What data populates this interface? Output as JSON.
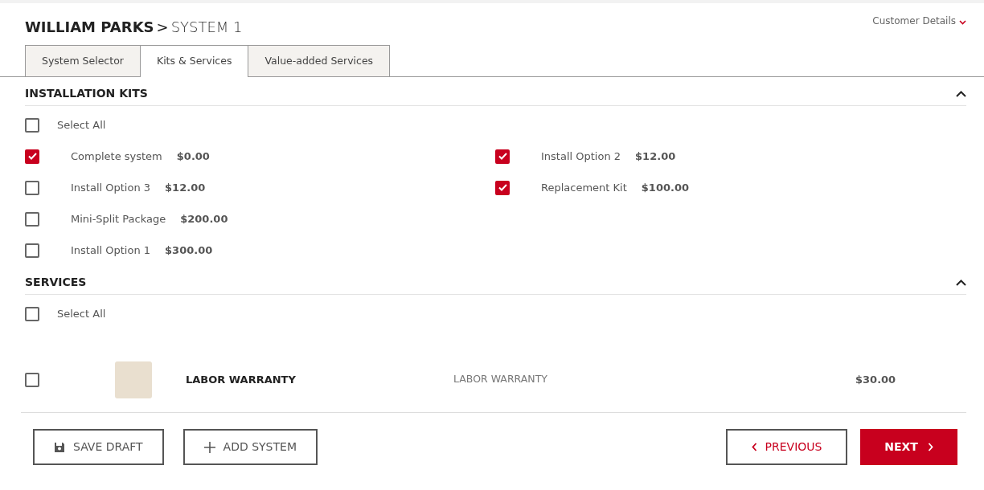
{
  "breadcrumb": {
    "customer": "WILLIAM PARKS",
    "separator": ">",
    "system": "SYSTEM 1"
  },
  "customer_details": {
    "label": "Customer Details",
    "expanded": false
  },
  "tabs": [
    {
      "label": "System Selector",
      "selected": false
    },
    {
      "label": "Kits & Services",
      "selected": true
    },
    {
      "label": "Value-added Services",
      "selected": false
    }
  ],
  "installation_kits": {
    "title": "INSTALLATION KITS",
    "expanded": true,
    "select_all": {
      "label": "Select All",
      "checked": false
    },
    "columns": [
      [
        {
          "name": "Complete system",
          "price": "$0.00",
          "checked": true
        },
        {
          "name": "Install Option 3",
          "price": "$12.00",
          "checked": false
        },
        {
          "name": "Mini-Split Package",
          "price": "$200.00",
          "checked": false
        },
        {
          "name": "Install Option 1",
          "price": "$300.00",
          "checked": false
        }
      ],
      [
        {
          "name": "Install Option 2",
          "price": "$12.00",
          "checked": true
        },
        {
          "name": "Replacement Kit",
          "price": "$100.00",
          "checked": true
        }
      ]
    ]
  },
  "services": {
    "title": "SERVICES",
    "expanded": true,
    "select_all": {
      "label": "Select All",
      "checked": false
    },
    "items": [
      {
        "name": "LABOR WARRANTY",
        "description": "LABOR WARRANTY",
        "price": "$30.00",
        "checked": false
      }
    ]
  },
  "buttons": {
    "save_draft": "SAVE DRAFT",
    "add_system": "ADD SYSTEM",
    "previous": "PREVIOUS",
    "next": "NEXT"
  }
}
